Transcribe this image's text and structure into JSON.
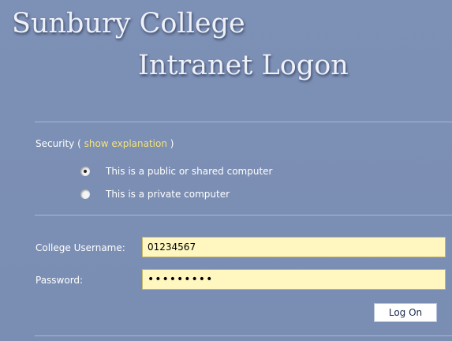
{
  "header": {
    "title_line1": "Sunbury College",
    "title_line2": "Intranet Logon"
  },
  "security": {
    "label_prefix": "Security ( ",
    "link_text": "show explanation",
    "label_suffix": " )",
    "options": [
      {
        "label": "This is a public or shared computer",
        "selected": true
      },
      {
        "label": "This is a private computer",
        "selected": false
      }
    ]
  },
  "form": {
    "username_label": "College Username:",
    "username_value": "01234567",
    "password_label": "Password:",
    "password_value": "123456789",
    "submit_label": "Log On"
  },
  "colors": {
    "background": "#7b8fb4",
    "link": "#f4e37a",
    "input_background": "#fff7bf"
  }
}
